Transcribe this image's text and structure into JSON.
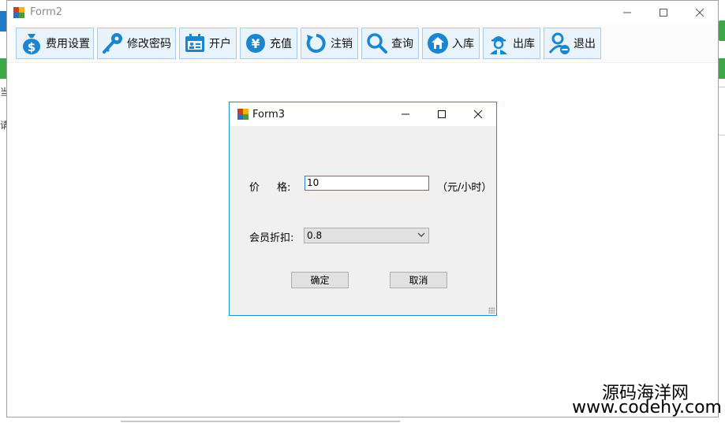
{
  "background": {
    "left_text_1": "当",
    "left_text_2": "请"
  },
  "form2": {
    "title": "Form2",
    "controls": {
      "minimize": "—",
      "maximize": "☐",
      "close": "✕"
    },
    "toolbar": [
      {
        "label": "费用设置",
        "icon": "money-bag-icon"
      },
      {
        "label": "修改密码",
        "icon": "key-icon"
      },
      {
        "label": "开户",
        "icon": "calendar-card-icon"
      },
      {
        "label": "充值",
        "icon": "yen-coin-icon"
      },
      {
        "label": "注销",
        "icon": "refresh-icon"
      },
      {
        "label": "查询",
        "icon": "search-icon"
      },
      {
        "label": "入库",
        "icon": "home-icon"
      },
      {
        "label": "出库",
        "icon": "worker-icon"
      },
      {
        "label": "退出",
        "icon": "user-exit-icon"
      }
    ]
  },
  "form3": {
    "title": "Form3",
    "controls": {
      "minimize": "—",
      "maximize": "☐",
      "close": "✕"
    },
    "price_label_a": "价",
    "price_label_b": "格:",
    "price_value": "10",
    "price_unit": "（元/小时）",
    "discount_label": "会员折扣:",
    "discount_value": "0.8",
    "ok_label": "确定",
    "cancel_label": "取消"
  },
  "watermark": {
    "line1": "源码海洋网",
    "line2": "www.codehy.com"
  },
  "colors": {
    "toolbar_button_bg": "#e9f3fc",
    "toolbar_button_border": "#a6cdee",
    "icon_blue": "#1a86d0",
    "dialog_border": "#1e8fd6"
  }
}
